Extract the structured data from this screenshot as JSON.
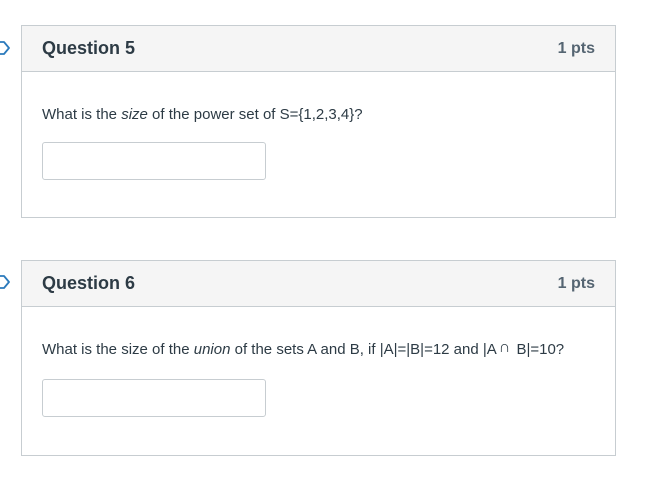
{
  "questions": [
    {
      "title": "Question 5",
      "points": "1 pts",
      "text_before": "What is the ",
      "text_em": "size",
      "text_after": " of the power set of S={1,2,3,4}?",
      "answer_value": ""
    },
    {
      "title": "Question 6",
      "points": "1 pts",
      "text_before": "What is the size of the ",
      "text_em": "union",
      "text_mid": " of the sets A and B, if |A|=|B|=12 and |A",
      "intersection_symbol": "∩",
      "text_after": " B|=10?",
      "answer_value": ""
    }
  ],
  "icons": {
    "flag_icon": "flag-icon"
  },
  "colors": {
    "border": "#c7cdd1",
    "header_bg": "#f5f5f5",
    "text": "#2d3b45",
    "flag": "#2b7abc"
  }
}
